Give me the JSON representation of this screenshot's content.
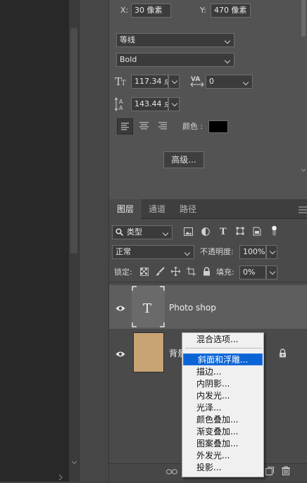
{
  "transform": {
    "x_label": "X:",
    "x_value": "30 像素",
    "y_label": "Y:",
    "y_value": "470 像素"
  },
  "character": {
    "font_family": "等线",
    "font_style": "Bold",
    "font_size": "117.34 点",
    "tracking": "0",
    "leading": "143.44 点",
    "color_label": "颜色 :",
    "color": "#000000",
    "advanced_button": "高级..."
  },
  "layers_panel": {
    "tabs": [
      "图层",
      "通道",
      "路径"
    ],
    "filter_type": "类型",
    "blend_mode": "正常",
    "opacity_label": "不透明度:",
    "opacity_value": "100%",
    "lock_label": "锁定:",
    "fill_label": "填充:",
    "fill_value": "0%",
    "layers": [
      {
        "name": "Photo shop",
        "type": "text"
      },
      {
        "name": "背景",
        "type": "image",
        "thumb_color": "#c8a475"
      }
    ]
  },
  "context_menu": {
    "items": [
      "混合选项...",
      "斜面和浮雕...",
      "描边...",
      "内阴影...",
      "内发光...",
      "光泽...",
      "颜色叠加...",
      "渐变叠加...",
      "图案叠加...",
      "外发光...",
      "投影..."
    ],
    "selected_index": 1
  },
  "colors": {
    "accent": "#0a64d6",
    "panel": "#535353",
    "dark": "#282828"
  }
}
